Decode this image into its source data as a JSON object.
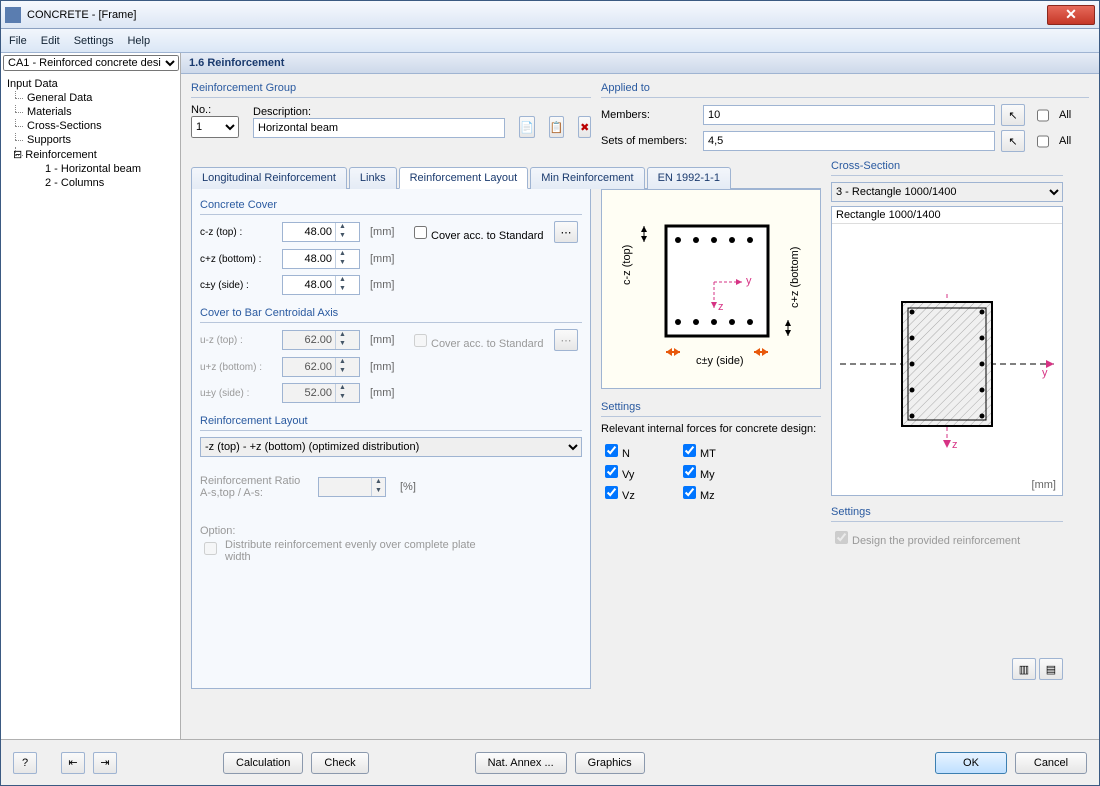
{
  "window_title": "CONCRETE - [Frame]",
  "menu": {
    "file": "File",
    "edit": "Edit",
    "settings": "Settings",
    "help": "Help"
  },
  "case_selector": "CA1 - Reinforced concrete desi",
  "tree": {
    "input_data": "Input Data",
    "general_data": "General Data",
    "materials": "Materials",
    "cross_sections": "Cross-Sections",
    "supports": "Supports",
    "reinforcement": "Reinforcement",
    "r1": "1 - Horizontal beam",
    "r2": "2 - Columns"
  },
  "page_title": "1.6 Reinforcement",
  "rg": {
    "title": "Reinforcement Group",
    "no_label": "No.:",
    "no_value": "1",
    "desc_label": "Description:",
    "desc_value": "Horizontal beam"
  },
  "applied": {
    "title": "Applied to",
    "members_label": "Members:",
    "members_value": "10",
    "sets_label": "Sets of members:",
    "sets_value": "4,5",
    "all": "All"
  },
  "tabs": {
    "long": "Longitudinal Reinforcement",
    "links": "Links",
    "layout": "Reinforcement Layout",
    "min": "Min Reinforcement",
    "en": "EN 1992-1-1"
  },
  "cover": {
    "title": "Concrete Cover",
    "cz_top_label": "c-z (top) :",
    "cz_top_val": "48.00",
    "czp_bot_label": "c+z (bottom) :",
    "czp_bot_val": "48.00",
    "cy_side_label": "c±y (side) :",
    "cy_side_val": "48.00",
    "unit": "[mm]",
    "according": "Cover acc. to Standard"
  },
  "centroid": {
    "title": "Cover to Bar Centroidal Axis",
    "uz_top_label": "u-z (top) :",
    "uz_top_val": "62.00",
    "uzp_bot_label": "u+z (bottom) :",
    "uzp_bot_val": "62.00",
    "uy_side_label": "u±y (side) :",
    "uy_side_val": "52.00",
    "according": "Cover acc. to Standard"
  },
  "layout": {
    "title": "Reinforcement Layout",
    "select": "-z (top) - +z (bottom) (optimized distribution)",
    "ratio_label": "Reinforcement Ratio\nA-s,top / A-s:",
    "ratio_unit": "[%]",
    "option_label": "Option:",
    "option_chk": "Distribute reinforcement evenly over complete plate width"
  },
  "diagram_labels": {
    "cztop": "c-z (top)",
    "czbot": "c+z (bottom)",
    "cyside": "c±y (side)",
    "y": "y",
    "z": "z"
  },
  "settings": {
    "title": "Settings",
    "subtitle": "Relevant internal forces for concrete design:",
    "n": "N",
    "vy": "Vy",
    "vz": "Vz",
    "mt": "MT",
    "my": "My",
    "mz": "Mz"
  },
  "cs": {
    "title": "Cross-Section",
    "select": "3 - Rectangle 1000/1400",
    "label": "Rectangle 1000/1400",
    "unit": "[mm]",
    "settings_title": "Settings",
    "design_chk": "Design the provided reinforcement"
  },
  "footer": {
    "calc": "Calculation",
    "check": "Check",
    "annex": "Nat. Annex ...",
    "graphics": "Graphics",
    "ok": "OK",
    "cancel": "Cancel"
  }
}
